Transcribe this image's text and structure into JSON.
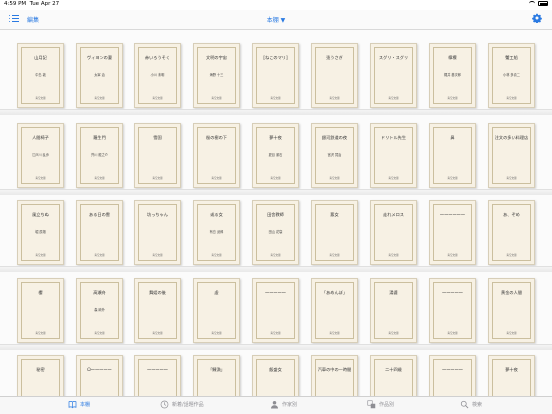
{
  "status": {
    "time": "4:59 PM",
    "date": "Tue Apr 27"
  },
  "nav": {
    "edit_label": "編集",
    "title": "本棚 ▼"
  },
  "shelf": {
    "rows": [
      [
        {
          "t": "山月記",
          "a": "中島 敦",
          "p": "青空文庫"
        },
        {
          "t": "ヴィヨンの妻",
          "a": "太宰 治",
          "p": "青空文庫"
        },
        {
          "t": "赤いろうそく",
          "a": "小川 未明",
          "p": "青空文庫"
        },
        {
          "t": "文明の宇宙",
          "a": "海野 十三",
          "p": "青空文庫"
        },
        {
          "t": "[ねこのマリ]",
          "a": "",
          "p": "青空文庫"
        },
        {
          "t": "兎うさぎ",
          "a": "",
          "p": "青空文庫"
        },
        {
          "t": "スグリ・スグリ",
          "a": "",
          "p": "青空文庫"
        },
        {
          "t": "檸檬",
          "a": "梶井 基次郎",
          "p": "青空文庫"
        },
        {
          "t": "蟹工船",
          "a": "小林 多喜二",
          "p": "青空文庫"
        }
      ],
      [
        {
          "t": "人間椅子",
          "a": "江戸川 乱歩",
          "p": "青空文庫"
        },
        {
          "t": "羅生門",
          "a": "芥川 龍之介",
          "p": "青空文庫"
        },
        {
          "t": "雪国",
          "a": "",
          "p": "青空文庫"
        },
        {
          "t": "桜の樹の下",
          "a": "",
          "p": "青空文庫"
        },
        {
          "t": "夢十夜",
          "a": "夏目 漱石",
          "p": "青空文庫"
        },
        {
          "t": "銀河鉄道の夜",
          "a": "宮沢 賢治",
          "p": "青空文庫"
        },
        {
          "t": "ドリトル先生",
          "a": "",
          "p": "青空文庫"
        },
        {
          "t": "鼻",
          "a": "",
          "p": "青空文庫"
        },
        {
          "t": "注文の多い料理店",
          "a": "",
          "p": "青空文庫"
        }
      ],
      [
        {
          "t": "風立ちぬ",
          "a": "堀 辰雄",
          "p": "青空文庫"
        },
        {
          "t": "ある日の雲",
          "a": "",
          "p": "青空文庫"
        },
        {
          "t": "坊っちゃん",
          "a": "",
          "p": "青空文庫"
        },
        {
          "t": "或る女",
          "a": "有島 武郎",
          "p": "青空文庫"
        },
        {
          "t": "田舎教師",
          "a": "田山 花袋",
          "p": "青空文庫"
        },
        {
          "t": "悪女",
          "a": "",
          "p": "青空文庫"
        },
        {
          "t": "走れメロス",
          "a": "",
          "p": "青空文庫"
        },
        {
          "t": "〜〜〜〜〜〜",
          "a": "",
          "p": "青空文庫"
        },
        {
          "t": "あ、ぞめ",
          "a": "",
          "p": "青空文庫"
        }
      ],
      [
        {
          "t": "櫻",
          "a": "",
          "p": "青空文庫"
        },
        {
          "t": "高瀬舟",
          "a": "森 鴎外",
          "p": "青空文庫"
        },
        {
          "t": "舞姫の後",
          "a": "",
          "p": "青空文庫"
        },
        {
          "t": "虚",
          "a": "",
          "p": "青空文庫"
        },
        {
          "t": "〜〜〜〜〜",
          "a": "",
          "p": "青空文庫"
        },
        {
          "t": "「あめんぼ」",
          "a": "",
          "p": "青空文庫"
        },
        {
          "t": "湯婆",
          "a": "",
          "p": "青空文庫"
        },
        {
          "t": "〜〜〜〜〜",
          "a": "",
          "p": "青空文庫"
        },
        {
          "t": "黄金の人間",
          "a": "",
          "p": "青空文庫"
        }
      ],
      [
        {
          "t": "秘密",
          "a": "",
          "p": "青空文庫"
        },
        {
          "t": "Ω〜〜〜〜〜",
          "a": "",
          "p": "青空文庫"
        },
        {
          "t": "〜〜〜〜〜",
          "a": "",
          "p": "青空文庫"
        },
        {
          "t": "「鰊漁」",
          "a": "",
          "p": "青空文庫"
        },
        {
          "t": "飯盛女",
          "a": "",
          "p": "青空文庫"
        },
        {
          "t": "汽車の中の一時間",
          "a": "",
          "p": "青空文庫"
        },
        {
          "t": "二十四歳",
          "a": "",
          "p": "青空文庫"
        },
        {
          "t": "〜〜〜〜〜",
          "a": "",
          "p": "青空文庫"
        },
        {
          "t": "夢十夜",
          "a": "",
          "p": "青空文庫"
        }
      ]
    ]
  },
  "tabs": [
    {
      "label": "本棚",
      "icon": "book-icon"
    },
    {
      "label": "新着/話題作品",
      "icon": "clock-icon"
    },
    {
      "label": "作家別",
      "icon": "person-icon"
    },
    {
      "label": "作品別",
      "icon": "stack-icon"
    },
    {
      "label": "検索",
      "icon": "search-icon"
    }
  ],
  "colors": {
    "accent": "#2a7ae2",
    "book_paper": "#f7f1e4"
  }
}
